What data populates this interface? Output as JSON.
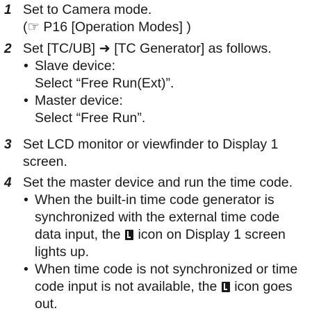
{
  "steps": [
    {
      "number": "1",
      "lines": [
        "Set to Camera mode.",
        "(☞ P16 [Operation Modes] )"
      ]
    },
    {
      "number": "2",
      "lines": [
        "Set [TC/UB] ➜ [TC Generator] as follows."
      ],
      "bullets": [
        {
          "lines": [
            "Slave device:",
            "Select “Free Run(Ext)”."
          ]
        },
        {
          "lines": [
            "Master device:",
            "Select “Free Run”."
          ]
        }
      ]
    },
    {
      "number": "3",
      "lines": [
        "Set LCD monitor or viewfinder to Display 1",
        "screen."
      ]
    },
    {
      "number": "4",
      "lines": [
        "Set the master device and run the time code."
      ],
      "bullets": [
        {
          "lines": [
            "When the built-in time code generator is",
            "synchronized with the external time code",
            "data input, the",
            "icon on Display 1 screen",
            "lights up."
          ]
        },
        {
          "lines": [
            "When time code is not synchronized or time",
            "code input is not available, the",
            "icon goes",
            "out."
          ]
        }
      ]
    }
  ],
  "icons": {
    "sync": "lock-icon"
  }
}
